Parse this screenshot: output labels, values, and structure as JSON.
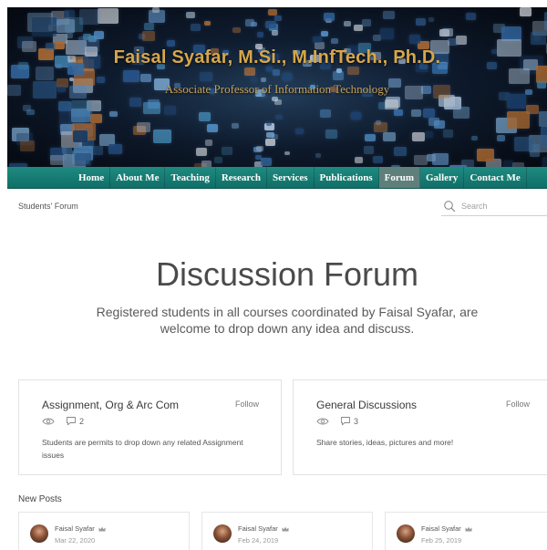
{
  "banner": {
    "title": "Faisal Syafar, M.Si., M.InfTech., Ph.D.",
    "subtitle": "Associate Professor of Information Technology"
  },
  "nav": {
    "items": [
      {
        "label": "Home"
      },
      {
        "label": "About Me"
      },
      {
        "label": "Teaching"
      },
      {
        "label": "Research"
      },
      {
        "label": "Services"
      },
      {
        "label": "Publications"
      },
      {
        "label": "Forum",
        "active": true
      },
      {
        "label": "Gallery"
      },
      {
        "label": "Contact Me"
      }
    ]
  },
  "forum": {
    "breadcrumb": "Students' Forum",
    "search_placeholder": "Search",
    "title": "Discussion Forum",
    "description": "Registered students in all courses coordinated by Faisal Syafar, are welcome to drop down any idea and discuss."
  },
  "categories": [
    {
      "title": "Assignment, Org & Arc Com",
      "follow_label": "Follow",
      "views_icon": "eye-icon",
      "posts_icon": "comment-icon",
      "posts_count": "2",
      "description": "Students are permits to drop down any related Assignment issues"
    },
    {
      "title": "General Discussions",
      "follow_label": "Follow",
      "views_icon": "eye-icon",
      "posts_icon": "comment-icon",
      "posts_count": "3",
      "description": "Share stories, ideas, pictures and more!"
    }
  ],
  "new_posts": {
    "label": "New Posts",
    "posts": [
      {
        "author": "Faisal Syafar",
        "date": "Mar 22, 2020"
      },
      {
        "author": "Faisal Syafar",
        "date": "Feb 24, 2019"
      },
      {
        "author": "Faisal Syafar",
        "date": "Feb 25, 2019"
      }
    ]
  },
  "colors": {
    "nav_bg": "#117a70",
    "nav_active": "#5f7f7b",
    "banner_title": "#d7a64a"
  }
}
